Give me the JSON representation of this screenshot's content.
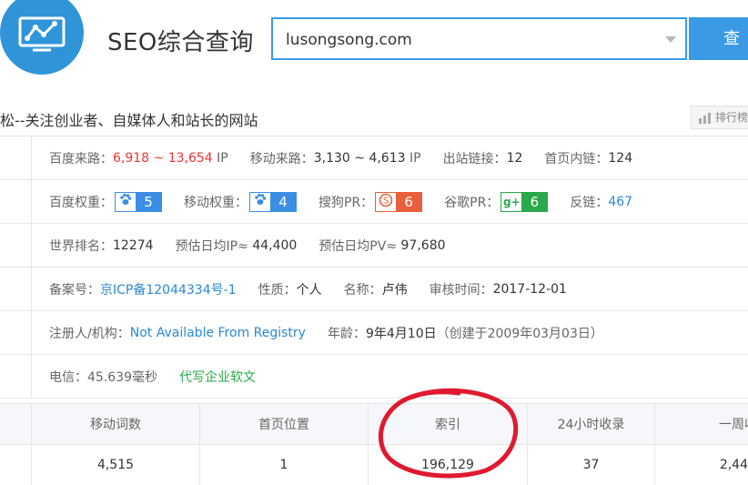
{
  "header": {
    "title": "SEO综合查询",
    "search_value": "lusongsong.com",
    "search_button": "查"
  },
  "site": {
    "subtitle": "松--关注创业者、自媒体人和站长的网站",
    "rank_button": "排行榜"
  },
  "traffic": {
    "baidu_label": "百度来路：",
    "baidu_value": "6,918 ~ 13,654",
    "baidu_unit": "IP",
    "mobile_label": "移动来路：",
    "mobile_value": "3,130 ~ 4,613",
    "mobile_unit": "IP",
    "outlinks_label": "出站链接：",
    "outlinks_value": "12",
    "inlinks_label": "首页内链：",
    "inlinks_value": "124"
  },
  "weights": {
    "baidu_label": "百度权重：",
    "baidu_value": "5",
    "mobile_label": "移动权重：",
    "mobile_value": "4",
    "sogou_label": "搜狗PR：",
    "sogou_value": "6",
    "google_label": "谷歌PR：",
    "google_value": "6",
    "google_icon_text": "g+",
    "backlinks_label": "反链：",
    "backlinks_value": "467"
  },
  "ranking": {
    "world_label": "世界排名：",
    "world_value": "12274",
    "ip_label": "预估日均IP≈",
    "ip_value": "44,400",
    "pv_label": "预估日均PV≈",
    "pv_value": "97,680"
  },
  "icp": {
    "record_label": "备案号：",
    "record_value": "京ICP备12044334号-1",
    "nature_label": "性质：",
    "nature_value": "个人",
    "name_label": "名称：",
    "name_value": "卢伟",
    "audit_label": "审核时间：",
    "audit_value": "2017-12-01"
  },
  "whois": {
    "registrant_label": "注册人/机构：",
    "registrant_value": "Not Available From Registry",
    "age_label": "年龄：",
    "age_value": "9年4月10日",
    "created_text": "（创建于2009年03月03日）"
  },
  "speed": {
    "text": "电信：45.639毫秒",
    "link": "代写企业软文"
  },
  "stats": {
    "headers": [
      "移动词数",
      "首页位置",
      "索引",
      "24小时收录",
      "一周收"
    ],
    "values": [
      "4,515",
      "1",
      "196,129",
      "37",
      "2,44"
    ]
  },
  "colors": {
    "accent": "#3a9ae6",
    "logo": "#2f95d8",
    "highlight": "#e33",
    "annotation": "#e0192e"
  },
  "icons": {
    "logo": "chart-monitor-icon",
    "dropdown": "chevron-down-icon",
    "paw": "paw-icon",
    "sogou": "sogou-icon",
    "google": "google-plus-icon",
    "rank": "bar-chart-icon"
  }
}
